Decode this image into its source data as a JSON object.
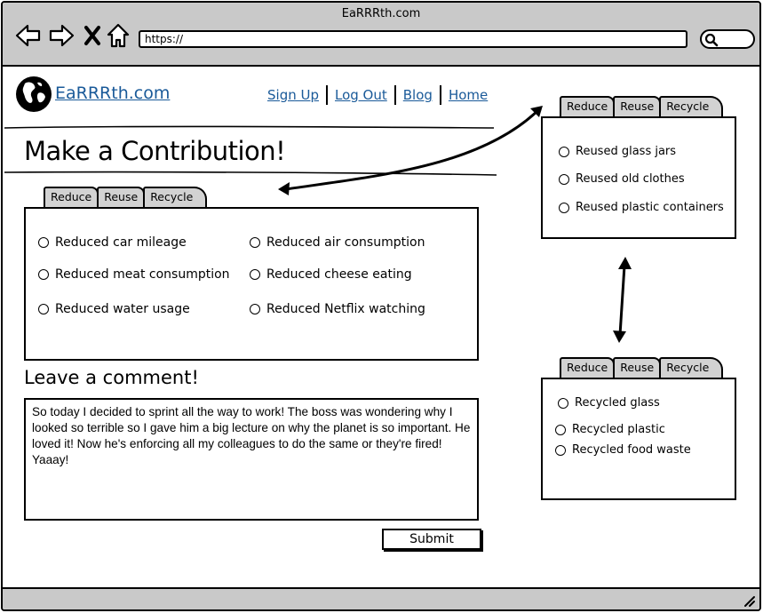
{
  "window": {
    "title": "EaRRRth.com"
  },
  "browser": {
    "url": "https://"
  },
  "site": {
    "logo_text": "EaRRRth.com"
  },
  "nav": {
    "sign_up": "Sign Up",
    "log_out": "Log Out",
    "blog": "Blog",
    "home": "Home"
  },
  "page": {
    "title": "Make a Contribution!"
  },
  "tabs": {
    "reduce": "Reduce",
    "reuse": "Reuse",
    "recycle": "Recycle"
  },
  "reduce_panel": {
    "options": [
      "Reduced car mileage",
      "Reduced air consumption",
      "Reduced meat consumption",
      "Reduced cheese eating",
      "Reduced water usage",
      "Reduced Netflix watching"
    ]
  },
  "reuse_panel": {
    "options": [
      "Reused glass jars",
      "Reused old clothes",
      "Reused plastic containers"
    ]
  },
  "recycle_panel": {
    "options": [
      "Recycled glass",
      "Recycled plastic",
      "Recycled food waste"
    ]
  },
  "comment": {
    "title": "Leave a comment!",
    "text": "So today I decided to sprint all the way to work! The boss was wondering why I looked so terrible so I gave him a big lecture on why the planet is so important. He loved it! Now he's enforcing all my colleagues to do the same or they're fired! Yaaay!"
  },
  "submit": {
    "label": "Submit"
  }
}
